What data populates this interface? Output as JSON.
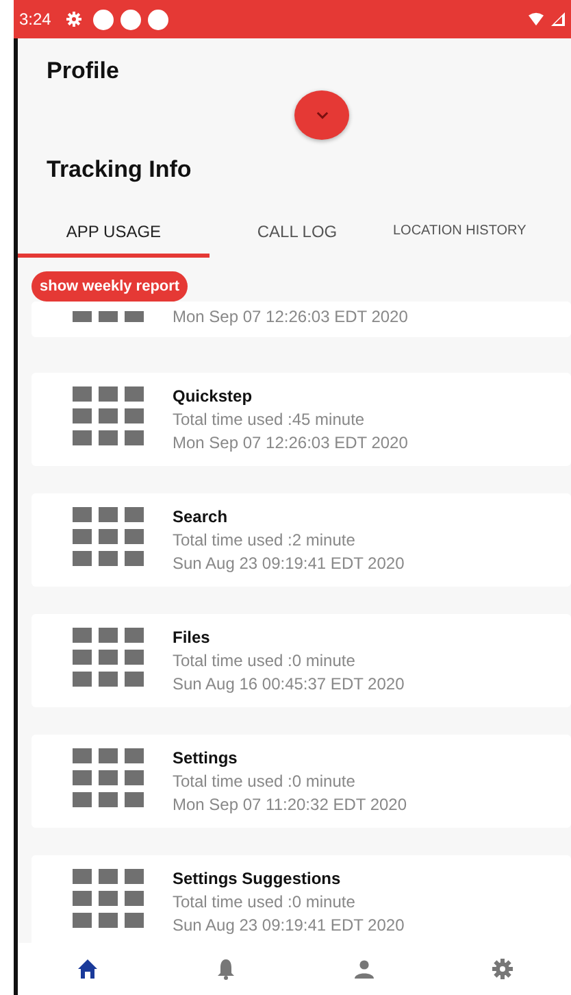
{
  "status_bar": {
    "time": "3:24"
  },
  "profile": {
    "title": "Profile"
  },
  "tracking": {
    "title": "Tracking Info"
  },
  "tabs": [
    {
      "label": "APP USAGE",
      "selected": true
    },
    {
      "label": "CALL LOG",
      "selected": false
    },
    {
      "label": "LOCATION HISTORY",
      "selected": false
    }
  ],
  "report_button": {
    "label": "show weekly report"
  },
  "apps": [
    {
      "date": "Mon Sep 07 12:26:03 EDT 2020"
    },
    {
      "name": "Quickstep",
      "usage": "Total time used :45 minute",
      "date": "Mon Sep 07 12:26:03 EDT 2020"
    },
    {
      "name": "Search",
      "usage": "Total time used :2 minute",
      "date": "Sun Aug 23 09:19:41 EDT 2020"
    },
    {
      "name": "Files",
      "usage": "Total time used :0 minute",
      "date": "Sun Aug 16 00:45:37 EDT 2020"
    },
    {
      "name": "Settings",
      "usage": "Total time used :0 minute",
      "date": "Mon Sep 07 11:20:32 EDT 2020"
    },
    {
      "name": "Settings Suggestions",
      "usage": "Total time used :0 minute",
      "date": "Sun Aug 23 09:19:41 EDT 2020"
    }
  ],
  "bottom_nav": [
    {
      "kind": "home",
      "selected": true
    },
    {
      "kind": "bell",
      "selected": false
    },
    {
      "kind": "person",
      "selected": false
    },
    {
      "kind": "gear",
      "selected": false
    }
  ]
}
